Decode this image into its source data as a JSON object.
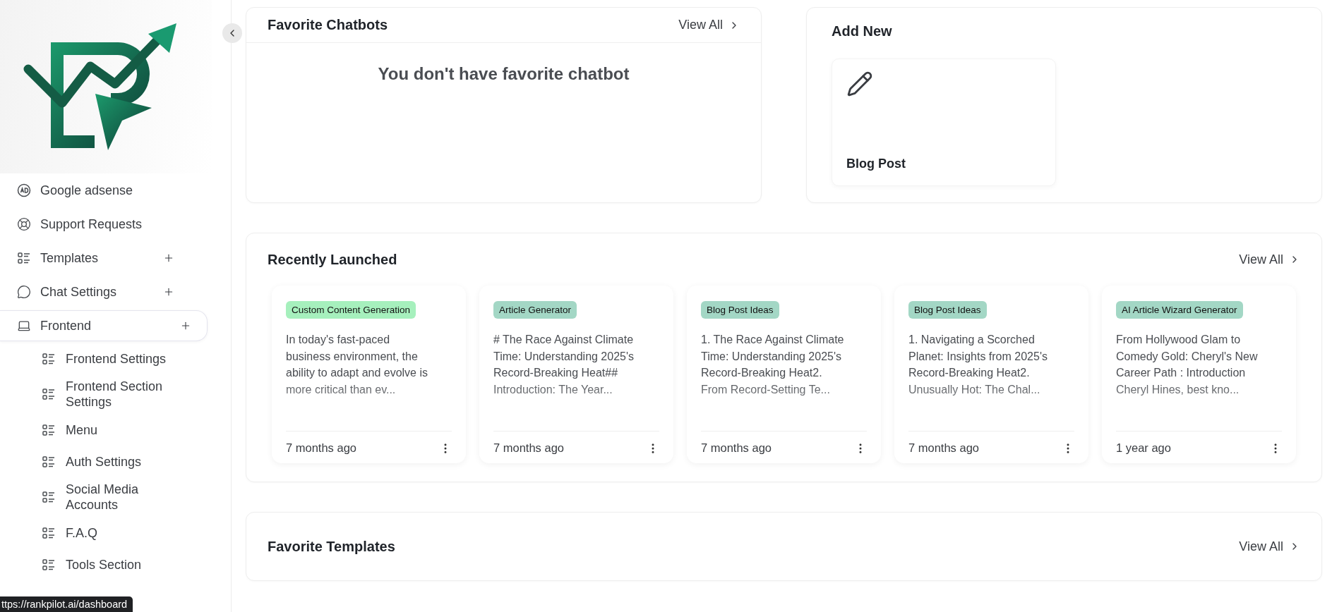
{
  "sidebar": {
    "items": [
      {
        "label": "Google adsense",
        "kind": "link",
        "selected": false
      },
      {
        "label": "Support Requests",
        "kind": "link",
        "selected": false
      },
      {
        "label": "Templates",
        "kind": "group",
        "selected": false
      },
      {
        "label": "Chat Settings",
        "kind": "group",
        "selected": false
      },
      {
        "label": "Frontend",
        "kind": "group",
        "selected": true,
        "children": [
          {
            "label": "Frontend Settings"
          },
          {
            "label": "Frontend Section Settings"
          },
          {
            "label": "Menu"
          },
          {
            "label": "Auth Settings"
          },
          {
            "label": "Social Media Accounts"
          },
          {
            "label": "F.A.Q"
          },
          {
            "label": "Tools Section"
          }
        ]
      }
    ]
  },
  "status_url": "ttps://rankpilot.ai/dashboard",
  "favorite_chatbots": {
    "title": "Favorite Chatbots",
    "view_all": "View All",
    "empty_message": "You don't have favorite chatbot"
  },
  "add_new": {
    "title": "Add New",
    "items": [
      {
        "label": "Blog Post"
      }
    ]
  },
  "recently_launched": {
    "title": "Recently Launched",
    "view_all": "View All",
    "cards": [
      {
        "tag": "Custom Content Generation",
        "color": "#a6f0bd",
        "text": "In today's fast-paced business environment, the ability to adapt and evolve is more critical than ev...",
        "time": "7 months ago"
      },
      {
        "tag": "Article Generator",
        "color": "#a3d7c5",
        "text": "# The Race Against Climate Time: Understanding 2025's Record-Breaking Heat## Introduction: The Year...",
        "time": "7 months ago"
      },
      {
        "tag": "Blog Post Ideas",
        "color": "#a3d7c5",
        "text": "1. The Race Against Climate Time: Understanding 2025's Record-Breaking Heat2. From Record-Setting Te...",
        "time": "7 months ago"
      },
      {
        "tag": "Blog Post Ideas",
        "color": "#a3d7c5",
        "text": "1. Navigating a Scorched Planet: Insights from 2025's Record-Breaking Heat2. Unusually Hot: The Chal...",
        "time": "7 months ago"
      },
      {
        "tag": "AI Article Wizard Generator",
        "color": "#a3d7c5",
        "text": "From Hollywood Glam to Comedy Gold: Cheryl's New Career Path : Introduction Cheryl Hines, best kno...",
        "time": "1 year ago"
      }
    ]
  },
  "favorite_templates": {
    "title": "Favorite Templates",
    "view_all": "View All"
  }
}
